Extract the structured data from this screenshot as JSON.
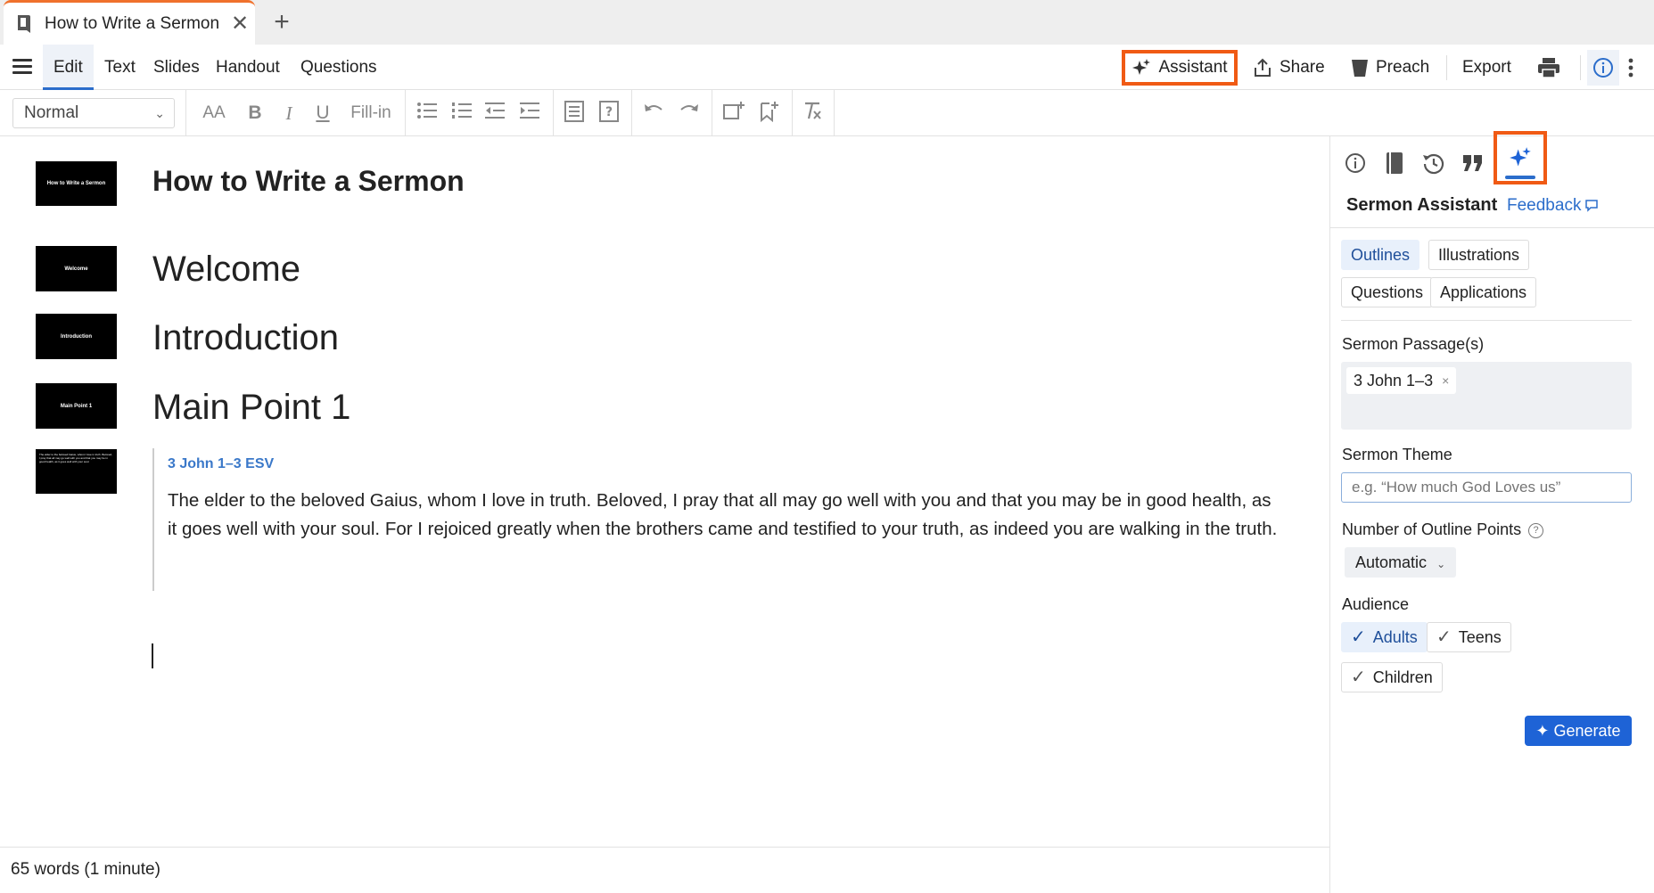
{
  "tabs": {
    "title": "How to Write a Sermon",
    "close_glyph": "✕",
    "new_glyph": "+"
  },
  "menu": {
    "items": [
      "Edit",
      "Text",
      "Slides",
      "Handout",
      "Questions"
    ],
    "assistant": "Assistant",
    "share": "Share",
    "preach": "Preach",
    "export": "Export"
  },
  "toolbar": {
    "style_value": "Normal",
    "fill_in": "Fill-in",
    "font_size_glyph": "AA",
    "bold": "B",
    "italic": "I",
    "underline": "U"
  },
  "document": {
    "title": "How to Write a Sermon",
    "headings": [
      "Welcome",
      "Introduction",
      "Main Point 1"
    ],
    "thumbs": [
      "How to Write a Sermon",
      "Welcome",
      "Introduction",
      "Main Point 1",
      "The elder to the beloved Gaius, whom I love in truth. Beloved, I pray that all may go well with you and that you may be in good health, as it goes well with your soul."
    ],
    "scripture_ref": "3 John 1–3 ESV",
    "scripture_text": "The elder to the beloved Gaius, whom I love in truth. Beloved, I pray that all may go well with you and that you may be in good health, as it goes well with your soul. For I rejoiced greatly when the brothers came and testified to your truth, as indeed you are walking in the truth."
  },
  "status": {
    "word_count": "65 words (1 minute)"
  },
  "panel": {
    "title": "Sermon Assistant",
    "feedback": "Feedback",
    "modes": [
      "Outlines",
      "Illustrations",
      "Questions",
      "Applications"
    ],
    "passage_label": "Sermon Passage(s)",
    "passage_value": "3 John 1–3",
    "passage_remove": "×",
    "theme_label": "Sermon Theme",
    "theme_placeholder": "e.g. “How much God Loves us”",
    "points_label": "Number of Outline Points",
    "points_value": "Automatic",
    "audience_label": "Audience",
    "audience": [
      "Adults",
      "Teens",
      "Children"
    ],
    "generate": "Generate"
  },
  "colors": {
    "accent": "#2b6dcb",
    "highlight": "#f05a14",
    "primary_button": "#1e63d6",
    "tab_indicator": "#f0712c"
  }
}
